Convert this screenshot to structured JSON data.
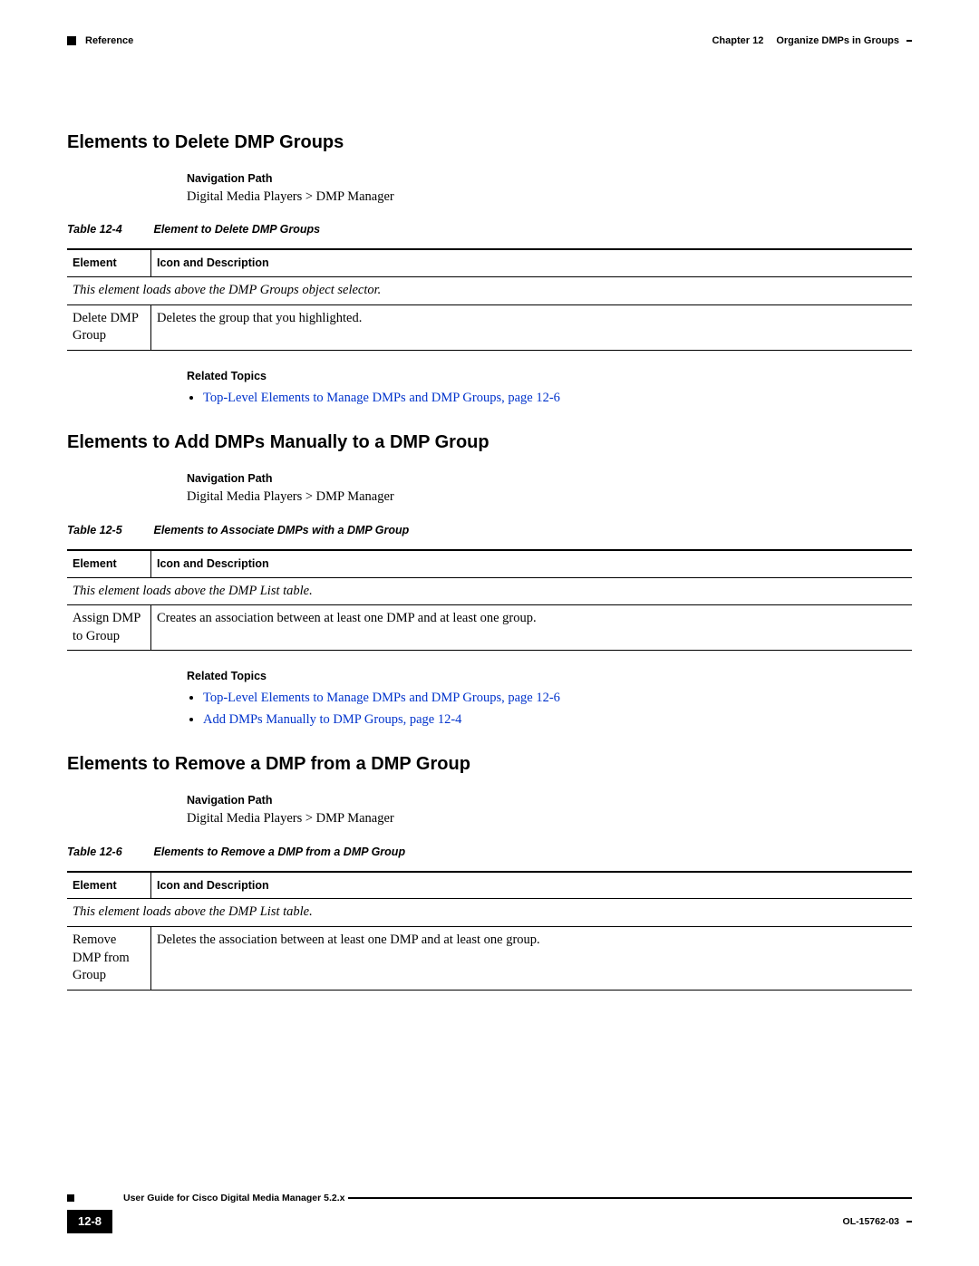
{
  "header": {
    "left_label": "Reference",
    "chapter_label": "Chapter 12",
    "chapter_title": "Organize DMPs in Groups"
  },
  "labels": {
    "nav_path": "Navigation Path",
    "related_topics": "Related Topics"
  },
  "table_headers": {
    "element": "Element",
    "icon_desc": "Icon and Description"
  },
  "sections": [
    {
      "title": "Elements to Delete DMP Groups",
      "nav_path_text": "Digital Media Players > DMP Manager",
      "table": {
        "number": "Table 12-4",
        "caption": "Element to Delete DMP Groups",
        "note": "This element loads above the DMP Groups object selector.",
        "rows": [
          {
            "element": "Delete DMP Group",
            "desc": "Deletes the group that you highlighted."
          }
        ]
      },
      "related": [
        "Top-Level Elements to Manage DMPs and DMP Groups, page 12-6"
      ]
    },
    {
      "title": "Elements to Add DMPs Manually to a DMP Group",
      "nav_path_text": "Digital Media Players > DMP Manager",
      "table": {
        "number": "Table 12-5",
        "caption": "Elements to Associate DMPs with a DMP Group",
        "note": "This element loads above the DMP List table.",
        "rows": [
          {
            "element": "Assign DMP to Group",
            "desc": "Creates an association between at least one DMP and at least one group."
          }
        ]
      },
      "related": [
        "Top-Level Elements to Manage DMPs and DMP Groups, page 12-6",
        "Add DMPs Manually to DMP Groups, page 12-4"
      ]
    },
    {
      "title": "Elements to Remove a DMP from a DMP Group",
      "nav_path_text": "Digital Media Players > DMP Manager",
      "table": {
        "number": "Table 12-6",
        "caption": "Elements to Remove a DMP from a DMP Group",
        "note": "This element loads above the DMP List table.",
        "rows": [
          {
            "element": "Remove DMP from Group",
            "desc": "Deletes the association between at least one DMP and at least one group."
          }
        ]
      },
      "related": []
    }
  ],
  "footer": {
    "book_title": "User Guide for Cisco Digital Media Manager 5.2.x",
    "page_number": "12-8",
    "doc_id": "OL-15762-03"
  }
}
